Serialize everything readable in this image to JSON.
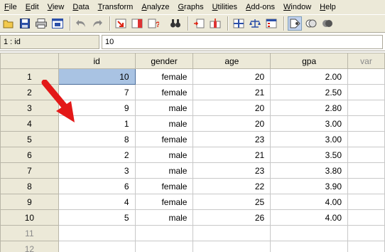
{
  "menu": [
    "File",
    "Edit",
    "View",
    "Data",
    "Transform",
    "Analyze",
    "Graphs",
    "Utilities",
    "Add-ons",
    "Window",
    "Help"
  ],
  "toolbar": {
    "icons": [
      "open-icon",
      "save-icon",
      "print-icon",
      "dialog-recall-icon",
      "undo-icon",
      "redo-icon",
      "goto-case-icon",
      "goto-variable-icon",
      "variables-icon",
      "find-icon",
      "insert-cases-icon",
      "insert-variable-icon",
      "split-file-icon",
      "weight-cases-icon",
      "select-cases-icon",
      "value-labels-icon",
      "use-sets-icon",
      "show-all-variables-icon"
    ]
  },
  "cell_ref": {
    "address": "1 : id",
    "value": "10"
  },
  "grid": {
    "columns": [
      "id",
      "gender",
      "age",
      "gpa",
      "var"
    ],
    "rows": [
      {
        "n": "1",
        "id": "10",
        "gender": "female",
        "age": "20",
        "gpa": "2.00"
      },
      {
        "n": "2",
        "id": "7",
        "gender": "female",
        "age": "21",
        "gpa": "2.50"
      },
      {
        "n": "3",
        "id": "9",
        "gender": "male",
        "age": "20",
        "gpa": "2.80"
      },
      {
        "n": "4",
        "id": "1",
        "gender": "male",
        "age": "20",
        "gpa": "3.00"
      },
      {
        "n": "5",
        "id": "8",
        "gender": "female",
        "age": "23",
        "gpa": "3.00"
      },
      {
        "n": "6",
        "id": "2",
        "gender": "male",
        "age": "21",
        "gpa": "3.50"
      },
      {
        "n": "7",
        "id": "3",
        "gender": "male",
        "age": "23",
        "gpa": "3.80"
      },
      {
        "n": "8",
        "id": "6",
        "gender": "female",
        "age": "22",
        "gpa": "3.90"
      },
      {
        "n": "9",
        "id": "4",
        "gender": "female",
        "age": "25",
        "gpa": "4.00"
      },
      {
        "n": "10",
        "id": "5",
        "gender": "male",
        "age": "26",
        "gpa": "4.00"
      }
    ],
    "empty_rows": [
      "11",
      "12"
    ]
  },
  "colors": {
    "selection": "#a9c3e3",
    "chrome": "#ece9d8",
    "arrow": "#e31818"
  }
}
